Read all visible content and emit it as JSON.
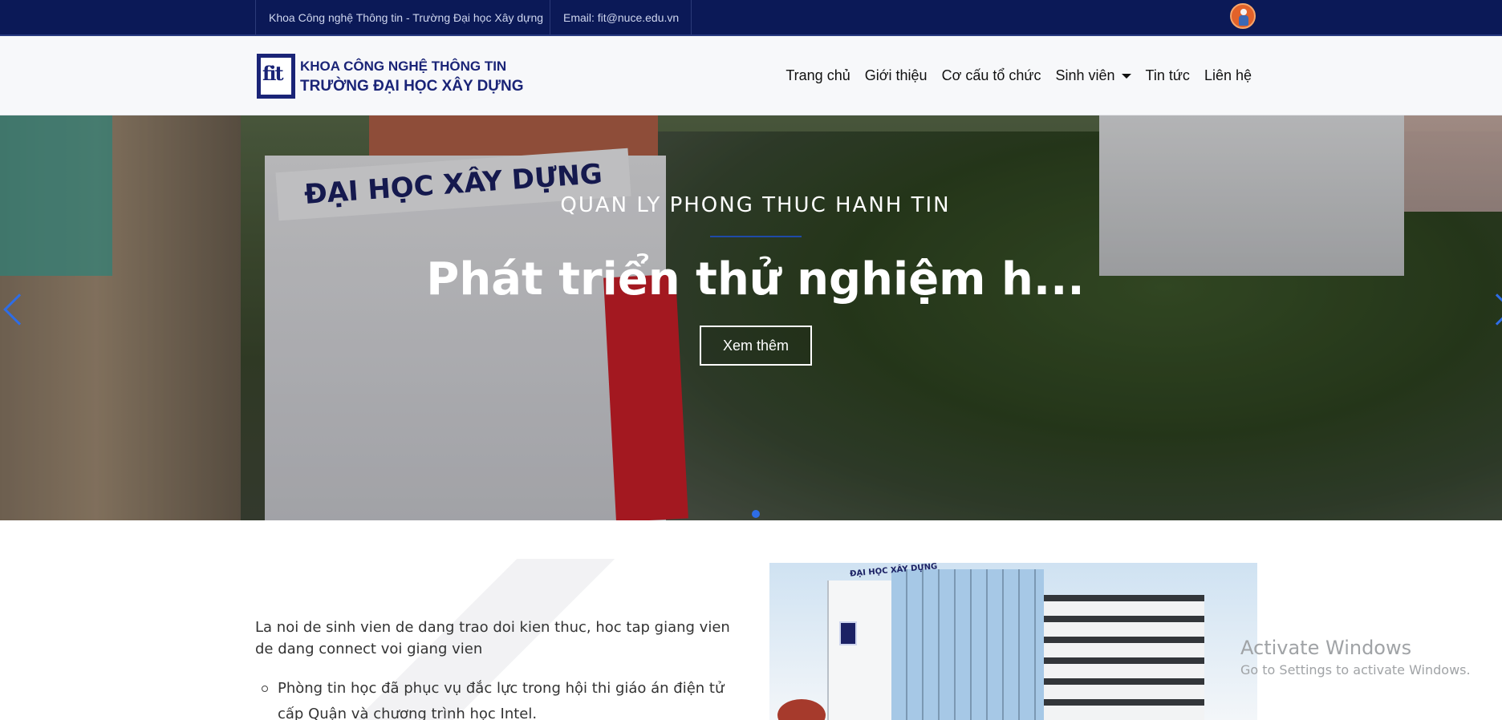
{
  "topbar": {
    "faculty_text": "Khoa Công nghệ Thông tin - Trường Đại học Xây dựng",
    "email_text": "Email: fit@nuce.edu.vn",
    "avatar_icon": "user-avatar-icon"
  },
  "navbar": {
    "logo_mark": "fit",
    "logo_line1": "KHOA CÔNG NGHỆ THÔNG TIN",
    "logo_line2": "TRƯỜNG ĐẠI HỌC XÂY DỰNG",
    "items": [
      {
        "label": "Trang chủ"
      },
      {
        "label": "Giới thiệu"
      },
      {
        "label": "Cơ cấu tổ chức"
      },
      {
        "label": "Sinh viên",
        "dropdown": true
      },
      {
        "label": "Tin tức"
      },
      {
        "label": "Liên hệ"
      }
    ]
  },
  "hero": {
    "photo_sign": "ĐẠI HỌC XÂY DỰNG",
    "subtitle": "QUAN LY PHONG THUC HANH TIN",
    "title": "Phát triển thử nghiệm h...",
    "button_label": "Xem thêm",
    "accent_color": "#2e6de6"
  },
  "content": {
    "intro": "La noi de sinh vien de dang trao doi kien thuc, hoc tap giang vien de dang connect voi giang vien",
    "list_items": [
      "Phòng tin học đã phục vụ đắc lực trong hội thi giáo án điện tử cấp Quận và chương trình học Intel."
    ],
    "photo_sign": "ĐẠI HỌC XÂY DỰNG"
  },
  "watermark": {
    "line1": "Activate Windows",
    "line2": "Go to Settings to activate Windows."
  }
}
